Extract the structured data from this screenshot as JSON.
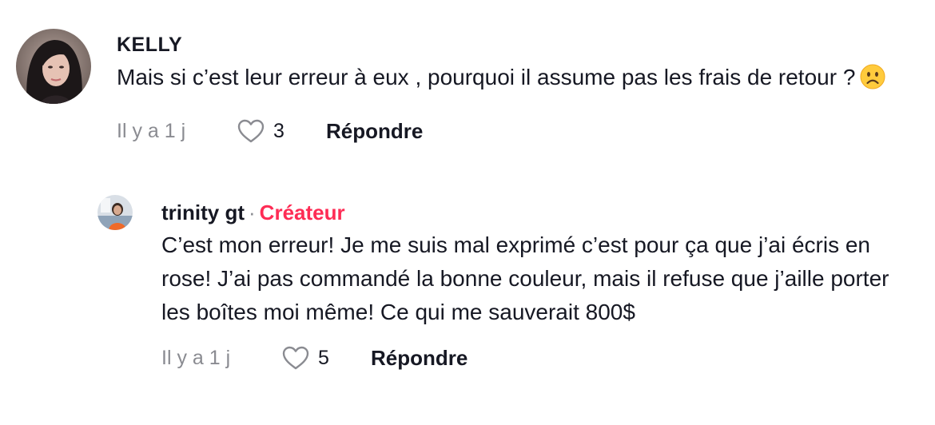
{
  "comments": [
    {
      "username": "KELLY",
      "text": "Mais si c’est leur erreur à eux , pourquoi il assume pas les frais de retour ?",
      "emoji": "frowning-face-emoji",
      "time": "Il y a 1 j",
      "likes": "3",
      "reply_label": "Répondre"
    },
    {
      "username": "trinity gt",
      "separator": "·",
      "badge": "Créateur",
      "text": "C’est mon erreur! Je me suis mal exprimé c’est pour ça que j’ai écris en rose! J’ai pas commandé la bonne couleur, mais il refuse que j’aille porter les boîtes moi même! Ce qui me sauverait 800$",
      "time": "Il y a 1 j",
      "likes": "5",
      "reply_label": "Répondre"
    }
  ],
  "colors": {
    "text": "#161823",
    "secondary": "#8a8b91",
    "creator_badge": "#fe2c55",
    "background": "#ffffff"
  }
}
